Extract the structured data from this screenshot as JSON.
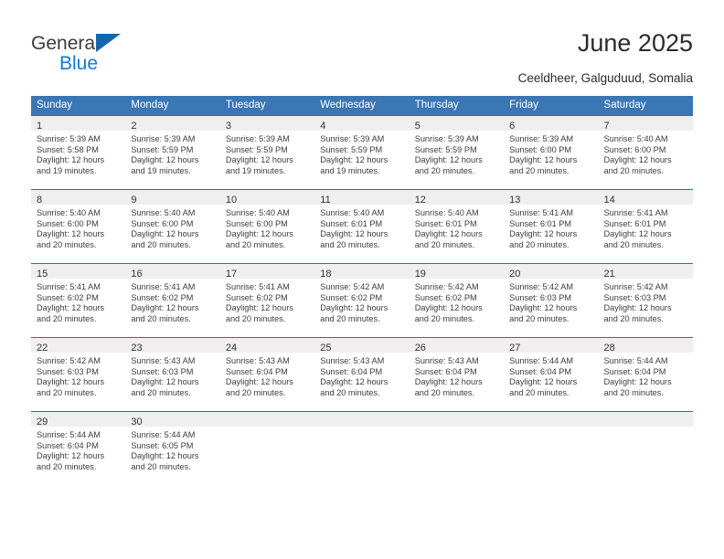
{
  "brand": {
    "name_top": "General",
    "name_bottom": "Blue",
    "triangle_icon": "blue-triangle-icon",
    "color_text": "#3b3b3b",
    "color_blue": "#1279d4"
  },
  "header": {
    "title": "June 2025",
    "subtitle": "Ceeldheer, Galguduud, Somalia"
  },
  "theme": {
    "header_blue": "#3b76b5",
    "row_divider_blue": "#2e6da7",
    "daynum_band": "#efefef"
  },
  "calendar": {
    "weekdays": [
      "Sunday",
      "Monday",
      "Tuesday",
      "Wednesday",
      "Thursday",
      "Friday",
      "Saturday"
    ],
    "weeks": [
      [
        {
          "day": "1",
          "sunrise": "Sunrise: 5:39 AM",
          "sunset": "Sunset: 5:58 PM",
          "daylight1": "Daylight: 12 hours",
          "daylight2": "and 19 minutes."
        },
        {
          "day": "2",
          "sunrise": "Sunrise: 5:39 AM",
          "sunset": "Sunset: 5:59 PM",
          "daylight1": "Daylight: 12 hours",
          "daylight2": "and 19 minutes."
        },
        {
          "day": "3",
          "sunrise": "Sunrise: 5:39 AM",
          "sunset": "Sunset: 5:59 PM",
          "daylight1": "Daylight: 12 hours",
          "daylight2": "and 19 minutes."
        },
        {
          "day": "4",
          "sunrise": "Sunrise: 5:39 AM",
          "sunset": "Sunset: 5:59 PM",
          "daylight1": "Daylight: 12 hours",
          "daylight2": "and 19 minutes."
        },
        {
          "day": "5",
          "sunrise": "Sunrise: 5:39 AM",
          "sunset": "Sunset: 5:59 PM",
          "daylight1": "Daylight: 12 hours",
          "daylight2": "and 20 minutes."
        },
        {
          "day": "6",
          "sunrise": "Sunrise: 5:39 AM",
          "sunset": "Sunset: 6:00 PM",
          "daylight1": "Daylight: 12 hours",
          "daylight2": "and 20 minutes."
        },
        {
          "day": "7",
          "sunrise": "Sunrise: 5:40 AM",
          "sunset": "Sunset: 6:00 PM",
          "daylight1": "Daylight: 12 hours",
          "daylight2": "and 20 minutes."
        }
      ],
      [
        {
          "day": "8",
          "sunrise": "Sunrise: 5:40 AM",
          "sunset": "Sunset: 6:00 PM",
          "daylight1": "Daylight: 12 hours",
          "daylight2": "and 20 minutes."
        },
        {
          "day": "9",
          "sunrise": "Sunrise: 5:40 AM",
          "sunset": "Sunset: 6:00 PM",
          "daylight1": "Daylight: 12 hours",
          "daylight2": "and 20 minutes."
        },
        {
          "day": "10",
          "sunrise": "Sunrise: 5:40 AM",
          "sunset": "Sunset: 6:00 PM",
          "daylight1": "Daylight: 12 hours",
          "daylight2": "and 20 minutes."
        },
        {
          "day": "11",
          "sunrise": "Sunrise: 5:40 AM",
          "sunset": "Sunset: 6:01 PM",
          "daylight1": "Daylight: 12 hours",
          "daylight2": "and 20 minutes."
        },
        {
          "day": "12",
          "sunrise": "Sunrise: 5:40 AM",
          "sunset": "Sunset: 6:01 PM",
          "daylight1": "Daylight: 12 hours",
          "daylight2": "and 20 minutes."
        },
        {
          "day": "13",
          "sunrise": "Sunrise: 5:41 AM",
          "sunset": "Sunset: 6:01 PM",
          "daylight1": "Daylight: 12 hours",
          "daylight2": "and 20 minutes."
        },
        {
          "day": "14",
          "sunrise": "Sunrise: 5:41 AM",
          "sunset": "Sunset: 6:01 PM",
          "daylight1": "Daylight: 12 hours",
          "daylight2": "and 20 minutes."
        }
      ],
      [
        {
          "day": "15",
          "sunrise": "Sunrise: 5:41 AM",
          "sunset": "Sunset: 6:02 PM",
          "daylight1": "Daylight: 12 hours",
          "daylight2": "and 20 minutes."
        },
        {
          "day": "16",
          "sunrise": "Sunrise: 5:41 AM",
          "sunset": "Sunset: 6:02 PM",
          "daylight1": "Daylight: 12 hours",
          "daylight2": "and 20 minutes."
        },
        {
          "day": "17",
          "sunrise": "Sunrise: 5:41 AM",
          "sunset": "Sunset: 6:02 PM",
          "daylight1": "Daylight: 12 hours",
          "daylight2": "and 20 minutes."
        },
        {
          "day": "18",
          "sunrise": "Sunrise: 5:42 AM",
          "sunset": "Sunset: 6:02 PM",
          "daylight1": "Daylight: 12 hours",
          "daylight2": "and 20 minutes."
        },
        {
          "day": "19",
          "sunrise": "Sunrise: 5:42 AM",
          "sunset": "Sunset: 6:02 PM",
          "daylight1": "Daylight: 12 hours",
          "daylight2": "and 20 minutes."
        },
        {
          "day": "20",
          "sunrise": "Sunrise: 5:42 AM",
          "sunset": "Sunset: 6:03 PM",
          "daylight1": "Daylight: 12 hours",
          "daylight2": "and 20 minutes."
        },
        {
          "day": "21",
          "sunrise": "Sunrise: 5:42 AM",
          "sunset": "Sunset: 6:03 PM",
          "daylight1": "Daylight: 12 hours",
          "daylight2": "and 20 minutes."
        }
      ],
      [
        {
          "day": "22",
          "sunrise": "Sunrise: 5:42 AM",
          "sunset": "Sunset: 6:03 PM",
          "daylight1": "Daylight: 12 hours",
          "daylight2": "and 20 minutes."
        },
        {
          "day": "23",
          "sunrise": "Sunrise: 5:43 AM",
          "sunset": "Sunset: 6:03 PM",
          "daylight1": "Daylight: 12 hours",
          "daylight2": "and 20 minutes."
        },
        {
          "day": "24",
          "sunrise": "Sunrise: 5:43 AM",
          "sunset": "Sunset: 6:04 PM",
          "daylight1": "Daylight: 12 hours",
          "daylight2": "and 20 minutes."
        },
        {
          "day": "25",
          "sunrise": "Sunrise: 5:43 AM",
          "sunset": "Sunset: 6:04 PM",
          "daylight1": "Daylight: 12 hours",
          "daylight2": "and 20 minutes."
        },
        {
          "day": "26",
          "sunrise": "Sunrise: 5:43 AM",
          "sunset": "Sunset: 6:04 PM",
          "daylight1": "Daylight: 12 hours",
          "daylight2": "and 20 minutes."
        },
        {
          "day": "27",
          "sunrise": "Sunrise: 5:44 AM",
          "sunset": "Sunset: 6:04 PM",
          "daylight1": "Daylight: 12 hours",
          "daylight2": "and 20 minutes."
        },
        {
          "day": "28",
          "sunrise": "Sunrise: 5:44 AM",
          "sunset": "Sunset: 6:04 PM",
          "daylight1": "Daylight: 12 hours",
          "daylight2": "and 20 minutes."
        }
      ],
      [
        {
          "day": "29",
          "sunrise": "Sunrise: 5:44 AM",
          "sunset": "Sunset: 6:04 PM",
          "daylight1": "Daylight: 12 hours",
          "daylight2": "and 20 minutes."
        },
        {
          "day": "30",
          "sunrise": "Sunrise: 5:44 AM",
          "sunset": "Sunset: 6:05 PM",
          "daylight1": "Daylight: 12 hours",
          "daylight2": "and 20 minutes."
        },
        {
          "day": "",
          "sunrise": "",
          "sunset": "",
          "daylight1": "",
          "daylight2": ""
        },
        {
          "day": "",
          "sunrise": "",
          "sunset": "",
          "daylight1": "",
          "daylight2": ""
        },
        {
          "day": "",
          "sunrise": "",
          "sunset": "",
          "daylight1": "",
          "daylight2": ""
        },
        {
          "day": "",
          "sunrise": "",
          "sunset": "",
          "daylight1": "",
          "daylight2": ""
        },
        {
          "day": "",
          "sunrise": "",
          "sunset": "",
          "daylight1": "",
          "daylight2": ""
        }
      ]
    ]
  }
}
